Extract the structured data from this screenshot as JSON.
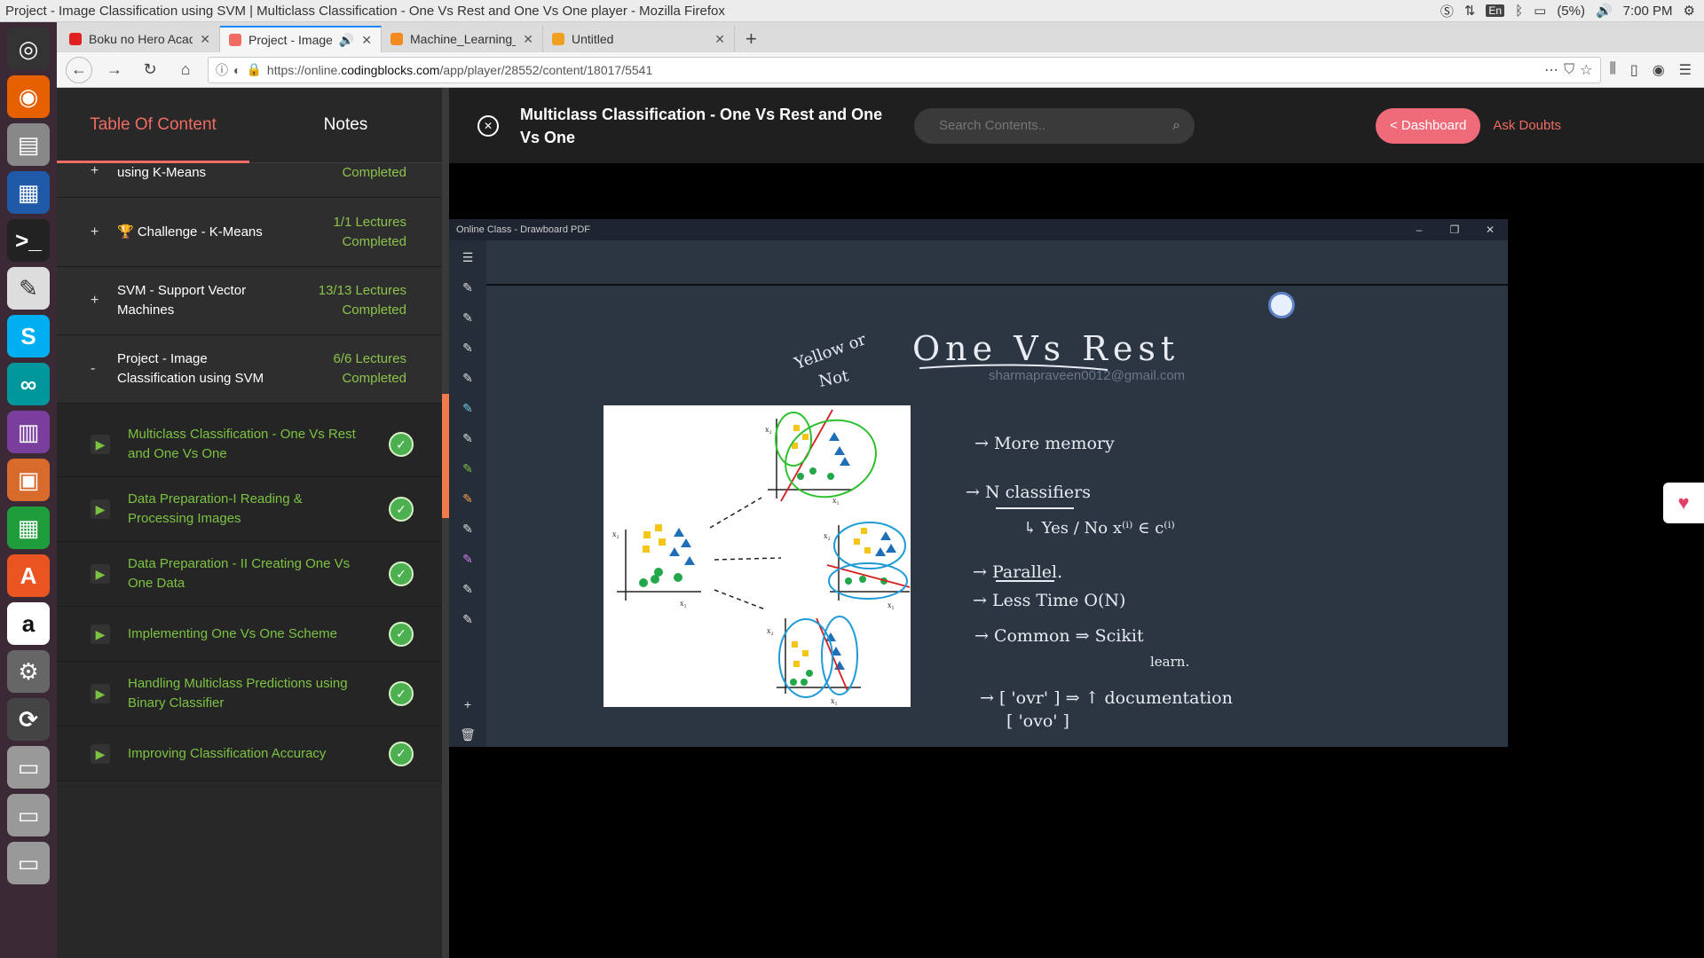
{
  "window": {
    "title": "Project - Image Classification using SVM | Multiclass Classification - One Vs Rest and One Vs One player - Mozilla Firefox"
  },
  "tray": {
    "lang": "En",
    "battery": "(5%)",
    "time": "7:00 PM"
  },
  "tabs": [
    {
      "label": "Boku no Hero Academia C",
      "color": "#e02020"
    },
    {
      "label": "Project - Image Classifi",
      "color": "#f06b63"
    },
    {
      "label": "Machine_Learning_Project",
      "color": "#f28a1e"
    },
    {
      "label": "Untitled",
      "color": "#f0a020"
    }
  ],
  "url": {
    "prefix": "https://online.",
    "domain": "codingblocks.com",
    "path": "/app/player/28552/content/18017/5541"
  },
  "sidebar": {
    "tab_toc": "Table Of Content",
    "tab_notes": "Notes",
    "sections": [
      {
        "sign": "+",
        "title": "using K-Means",
        "status": "Completed"
      },
      {
        "sign": "+",
        "title": "🏆 Challenge - K-Means",
        "status": "1/1 Lectures Completed"
      },
      {
        "sign": "+",
        "title": "SVM - Support Vector Machines",
        "status": "13/13 Lectures Completed"
      },
      {
        "sign": "-",
        "title": "Project - Image Classification using SVM",
        "status": "6/6 Lectures Completed"
      }
    ],
    "lectures": [
      "Multiclass Classification - One Vs Rest and One Vs One",
      "Data Preparation-I Reading & Processing Images",
      "Data Preparation - II Creating One Vs One Data",
      "Implementing One Vs One Scheme",
      "Handling Multiclass Predictions using Binary Classifier",
      "Improving Classification Accuracy"
    ]
  },
  "header": {
    "lecture_title": "Multiclass Classification - One Vs Rest and One Vs One",
    "search_placeholder": "Search Contents..",
    "dashboard": "< Dashboard",
    "ask": "Ask Doubts"
  },
  "board": {
    "app_title": "Online Class - Drawboard PDF",
    "watermark": "sharmapraveen0012@gmail.com",
    "heading": "One  Vs  Rest",
    "note_yellow": "Yellow or",
    "note_not": "Not",
    "points": [
      "→ More  memory",
      "→  N classifiers",
      "↳ Yes / No    x⁽ⁱ⁾ ∈ c⁽ⁱ⁾",
      "→ Parallel.",
      "→ Less Time   O(N)",
      "→ Common  ⇒  Scikit",
      "learn.",
      "→ [ 'ovr'  ]  ⇒  ↑ documentation",
      "[ 'ovo'  ]"
    ]
  }
}
